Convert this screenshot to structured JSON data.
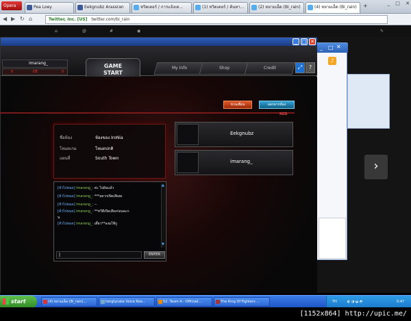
{
  "browser": {
    "opera_label": "Opera",
    "tabs": [
      {
        "label": "Pea Loey",
        "color": "#3b5998"
      },
      {
        "label": "Eekgnubz Arassran",
        "color": "#3b5998"
      },
      {
        "label": "ทวิตเตอร์ / การแจ้งเต...",
        "color": "#55acee"
      },
      {
        "label": "(1) ทวิตเตอร์ / ค้นหา...",
        "color": "#55acee"
      },
      {
        "label": "(2) หยามเอ็ด (Bi_rain)",
        "color": "#55acee"
      },
      {
        "label": "(4) หยามเอ็ด (Bi_rain)",
        "color": "#55acee"
      }
    ],
    "address": {
      "cert": "Twitter, Inc. [US]",
      "url": "twitter.com/bi_rain"
    }
  },
  "game": {
    "player": {
      "name": "imarang_",
      "stat_left": "0",
      "stat_mid": "DE",
      "stat_right": "0"
    },
    "game_start": {
      "line1": "GAME",
      "line2": "START"
    },
    "nav": {
      "my_info": "My Info",
      "shop": "Shop",
      "credit": "Credit"
    },
    "buttons": {
      "red": "ชวนเพื่อน",
      "blue": "ออกจากห้อง"
    },
    "red_label": "RED",
    "room_info": [
      {
        "key": "ชื่อห้อง",
        "value": "ห้องของ IroNia"
      },
      {
        "key": "โหมดเกม",
        "value": "โหมดปกติ"
      },
      {
        "key": "แผนที่",
        "value": "South Town"
      }
    ],
    "slots": [
      {
        "name": "Eekgnubz"
      },
      {
        "name": "imarang_"
      }
    ],
    "chat": [
      {
        "tag": "[ทั่วไปหมด]",
        "who": "imarang_:",
        "msg": "ค่ะ ไปยัมแล้ว"
      },
      {
        "tag": "[ทั่วไปหมด]",
        "who": "imarang_:",
        "msg": "***อยากเปิดเสียงด"
      },
      {
        "tag": "[ทั่วไปหมด]",
        "who": "imarang_:",
        "msg": "--"
      },
      {
        "tag": "[ทั่วไปหมด]",
        "who": "imarang_:",
        "msg": "**ทวีดีเปิดเสียงก่อนละก"
      },
      {
        "tag": "",
        "who": "",
        "msg": "   น"
      },
      {
        "tag": "[ทั่วไปหมด]",
        "who": "imarang_:",
        "msg": "เดี๋ยว**ลงมใช้กู"
      }
    ],
    "enter_label": "ENTER"
  },
  "taskbar": {
    "start": "start",
    "tasks": [
      {
        "label": "(4) หยามเอ็ด (Bi_rain)...",
        "color": "#d33"
      },
      {
        "label": "tongtycake Voice Roo...",
        "color": "#7ac"
      },
      {
        "label": "52. Team A - Officiall...",
        "color": "#e80"
      },
      {
        "label": "The King Of Fighters ...",
        "color": "#a33"
      }
    ],
    "lang": "TH",
    "clock": "0:47"
  },
  "watermark": "[1152x864] http://upic.me/"
}
